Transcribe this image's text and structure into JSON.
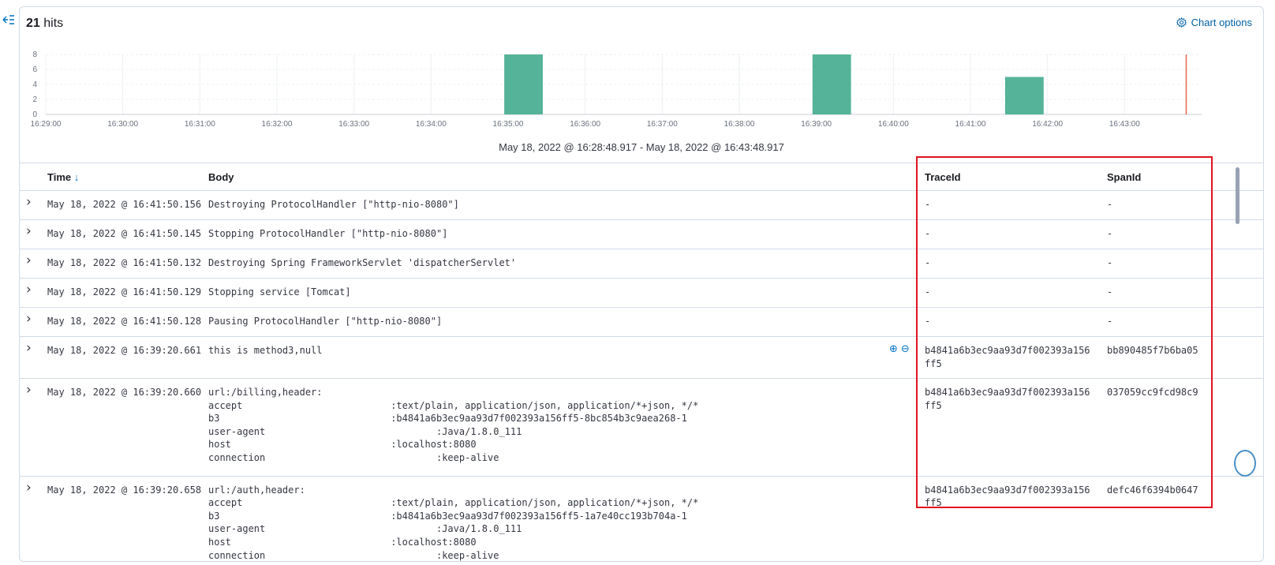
{
  "header": {
    "hits_count": "21",
    "hits_label": "hits",
    "chart_options_label": "Chart options"
  },
  "chart_data": {
    "type": "bar",
    "y_ticks": [
      "0",
      "2",
      "4",
      "6",
      "8"
    ],
    "ylim": [
      0,
      8
    ],
    "x_ticks": [
      "16:29:00",
      "16:30:00",
      "16:31:00",
      "16:32:00",
      "16:33:00",
      "16:34:00",
      "16:35:00",
      "16:36:00",
      "16:37:00",
      "16:38:00",
      "16:39:00",
      "16:40:00",
      "16:41:00",
      "16:42:00",
      "16:43:00"
    ],
    "xlim_minutes": [
      0,
      15
    ],
    "bars": [
      {
        "start_min": 5.95,
        "end_min": 6.45,
        "value": 8
      },
      {
        "start_min": 9.95,
        "end_min": 10.45,
        "value": 8
      },
      {
        "start_min": 12.45,
        "end_min": 12.95,
        "value": 5
      }
    ],
    "now_marker_min": 14.8,
    "bar_color": "#54b399",
    "marker_color": "#e7664c",
    "range_label": "May 18, 2022 @ 16:28:48.917 - May 18, 2022 @ 16:43:48.917"
  },
  "table": {
    "columns": {
      "time": "Time",
      "body": "Body",
      "trace": "TraceId",
      "span": "SpanId"
    },
    "rows": [
      {
        "time": "May 18, 2022 @ 16:41:50.156",
        "body": [
          "Destroying ProtocolHandler [\"http-nio-8080\"]"
        ],
        "trace": "-",
        "span": "-"
      },
      {
        "time": "May 18, 2022 @ 16:41:50.145",
        "body": [
          "Stopping ProtocolHandler [\"http-nio-8080\"]"
        ],
        "trace": "-",
        "span": "-"
      },
      {
        "time": "May 18, 2022 @ 16:41:50.132",
        "body": [
          "Destroying Spring FrameworkServlet 'dispatcherServlet'"
        ],
        "trace": "-",
        "span": "-"
      },
      {
        "time": "May 18, 2022 @ 16:41:50.129",
        "body": [
          "Stopping service [Tomcat]"
        ],
        "trace": "-",
        "span": "-"
      },
      {
        "time": "May 18, 2022 @ 16:41:50.128",
        "body": [
          "Pausing ProtocolHandler [\"http-nio-8080\"]"
        ],
        "trace": "-",
        "span": "-"
      },
      {
        "time": "May 18, 2022 @ 16:39:20.661",
        "body": [
          "this is method3,null"
        ],
        "trace": "b4841a6b3ec9aa93d7f002393a156ff5",
        "span": "bb890485f7b6ba05"
      },
      {
        "time": "May 18, 2022 @ 16:39:20.660",
        "body": [
          "url:/billing,header:",
          "accept                          :text/plain, application/json, application/*+json, */*",
          "b3                              :b4841a6b3ec9aa93d7f002393a156ff5-8bc854b3c9aea268-1",
          "user-agent                              :Java/1.8.0_111",
          "host                            :localhost:8080",
          "connection                              :keep-alive"
        ],
        "trace": "b4841a6b3ec9aa93d7f002393a156ff5",
        "span": "037059cc9fcd98c9"
      },
      {
        "time": "May 18, 2022 @ 16:39:20.658",
        "body": [
          "url:/auth,header:",
          "accept                          :text/plain, application/json, application/*+json, */*",
          "b3                              :b4841a6b3ec9aa93d7f002393a156ff5-1a7e40cc193b704a-1",
          "user-agent                              :Java/1.8.0_111",
          "host                            :localhost:8080",
          "connection                              :keep-alive"
        ],
        "trace": "b4841a6b3ec9aa93d7f002393a156ff5",
        "span": "defc46f6394b0647"
      }
    ]
  }
}
